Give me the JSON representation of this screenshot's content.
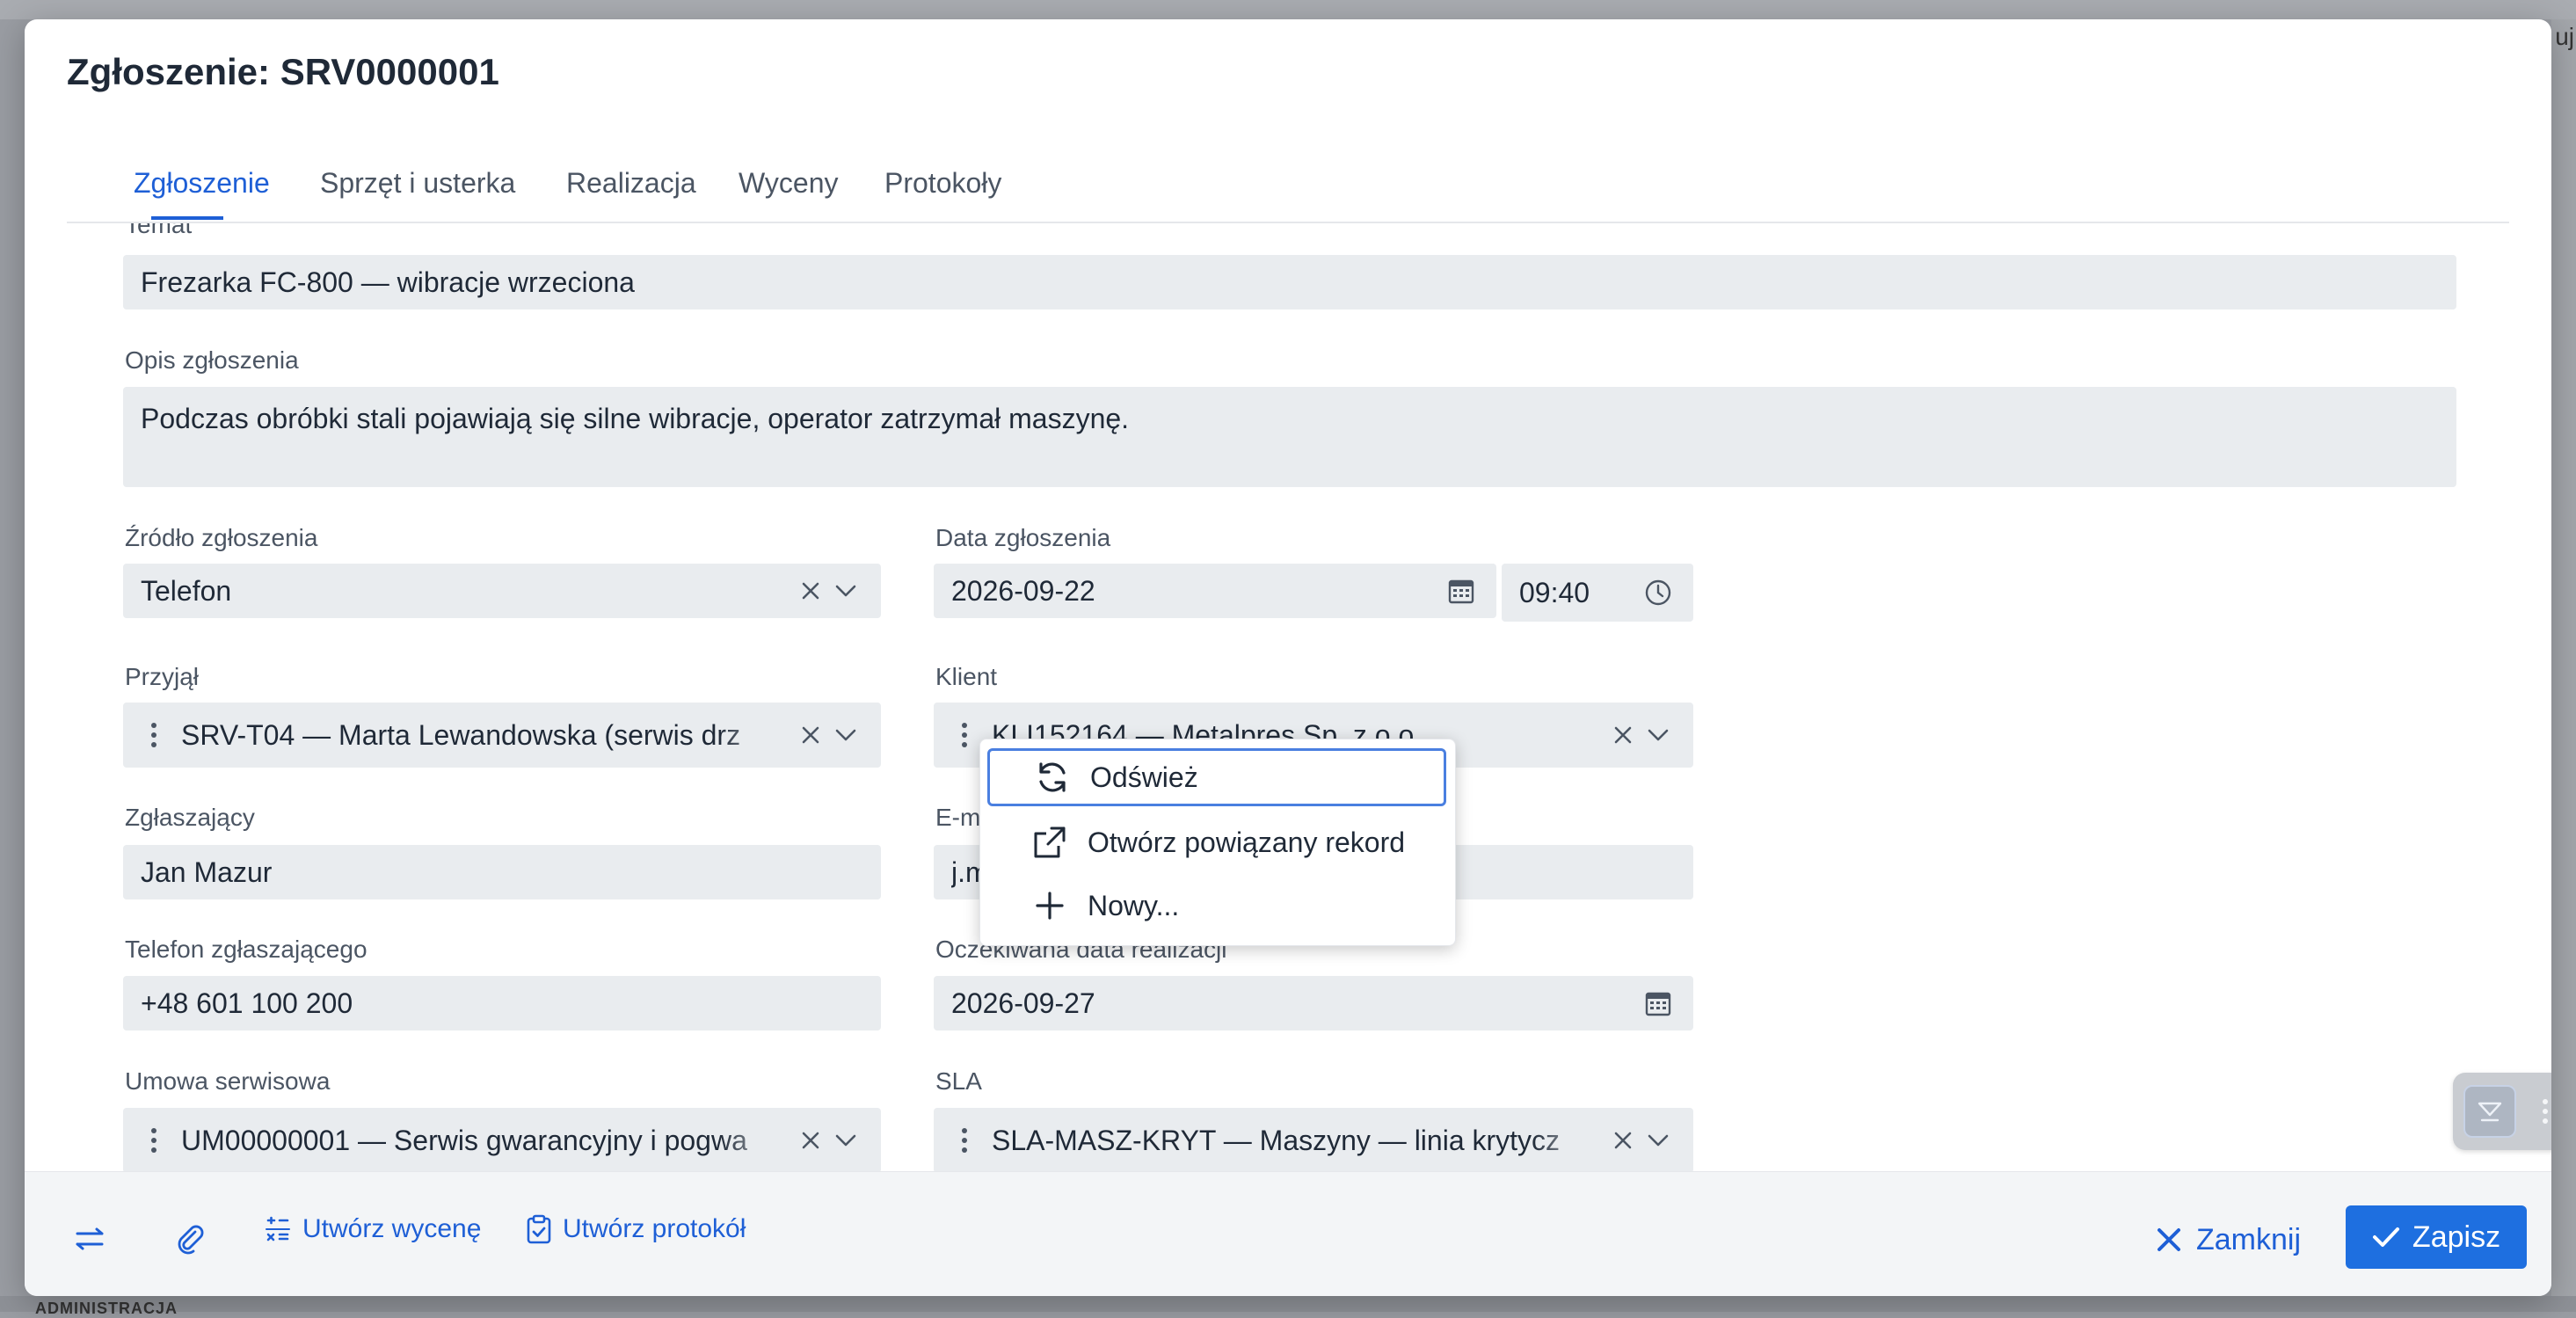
{
  "backdrop": {
    "corner_text": "uj",
    "bottom_text": "ADMINISTRACJA"
  },
  "modal": {
    "title": "Zgłoszenie: SRV0000001"
  },
  "tabs": [
    {
      "label": "Zgłoszenie",
      "active": true
    },
    {
      "label": "Sprzęt i usterka",
      "active": false
    },
    {
      "label": "Realizacja",
      "active": false
    },
    {
      "label": "Wyceny",
      "active": false
    },
    {
      "label": "Protokoły",
      "active": false
    }
  ],
  "form": {
    "temat": {
      "label": "Temat",
      "value": "Frezarka FC-800 — wibracje wrzeciona"
    },
    "opis": {
      "label": "Opis zgłoszenia",
      "value": "Podczas obróbki stali pojawiają się silne wibracje, operator zatrzymał maszynę."
    },
    "zrodlo": {
      "label": "Źródło zgłoszenia",
      "value": "Telefon"
    },
    "data_zgloszenia": {
      "label": "Data zgłoszenia",
      "date": "2026-09-22",
      "time": "09:40"
    },
    "przyjal": {
      "label": "Przyjął",
      "value": "SRV-T04 — Marta Lewandowska (serwis drz"
    },
    "klient": {
      "label": "Klient",
      "value": "KLI152164 — Metalpres Sp. z o.o."
    },
    "zglaszajacy": {
      "label": "Zgłaszający",
      "value": "Jan Mazur"
    },
    "email": {
      "label": "E-mail",
      "value": "j.m"
    },
    "telefon": {
      "label": "Telefon zgłaszającego",
      "value": "+48 601 100 200"
    },
    "oczekiwana": {
      "label": "Oczekiwana data realizacji",
      "value": "2026-09-27"
    },
    "umowa": {
      "label": "Umowa serwisowa",
      "value": "UM00000001 — Serwis gwarancyjny i pogwa"
    },
    "sla": {
      "label": "SLA",
      "value": "SLA-MASZ-KRYT — Maszyny — linia krytycz"
    }
  },
  "context_menu": {
    "items": [
      {
        "label": "Odśwież",
        "icon": "refresh-icon"
      },
      {
        "label": "Otwórz powiązany rekord",
        "icon": "external-link-icon"
      },
      {
        "label": "Nowy...",
        "icon": "plus-icon"
      }
    ]
  },
  "footer": {
    "create_quote_label": "Utwórz wycenę",
    "create_protocol_label": "Utwórz protokół",
    "close_label": "Zamknij",
    "save_label": "Zapisz"
  },
  "colors": {
    "accent": "#1e5fd6",
    "save_button": "#1e6fe0",
    "field_bg": "#e9ecef",
    "backdrop": "#9a9da3"
  }
}
